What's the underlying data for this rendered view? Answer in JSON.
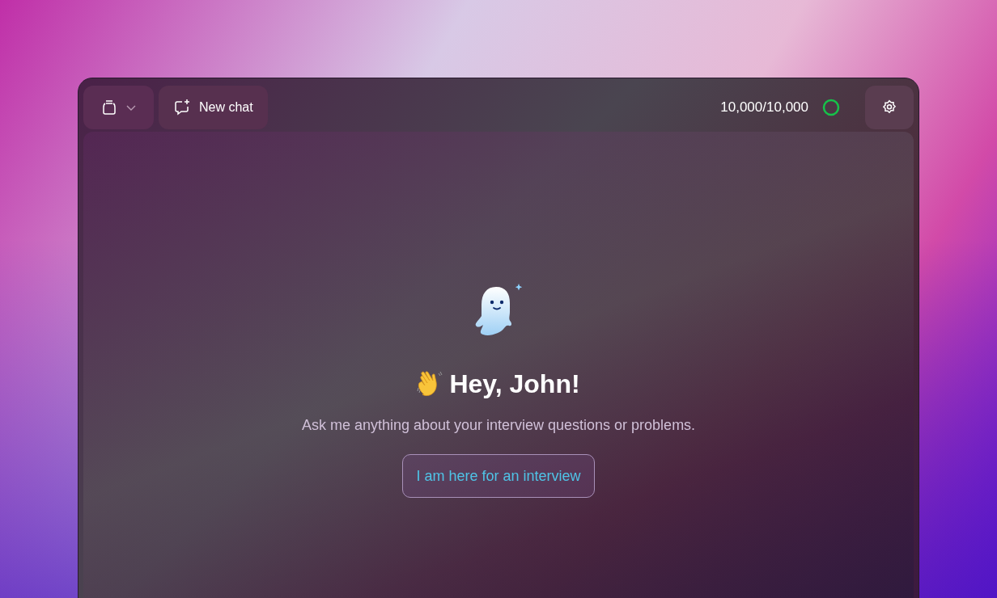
{
  "toolbar": {
    "new_chat": "New chat",
    "credits": {
      "reading": "10,000/10,000"
    }
  },
  "welcome": {
    "greeting": "Hey, John!",
    "subtitle": "Ask me anything about your interview questions or problems.",
    "suggestions": [
      "I am here for an interview"
    ]
  }
}
